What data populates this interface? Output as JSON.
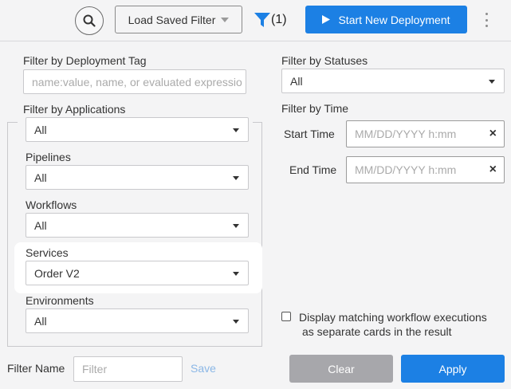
{
  "toolbar": {
    "search_icon": "search-icon",
    "load_saved_filter_label": "Load Saved Filter",
    "filter_count": "(1)",
    "filter_icon_color": "#1c80e4",
    "start_deployment_label": "Start New Deployment",
    "primary_color": "#1c80e4"
  },
  "left": {
    "tag_label": "Filter by Deployment Tag",
    "tag_placeholder": "name:value, name, or evaluated expressio",
    "apps_label": "Filter by Applications",
    "apps_value": "All",
    "pipelines_label": "Pipelines",
    "pipelines_value": "All",
    "workflows_label": "Workflows",
    "workflows_value": "All",
    "services_label": "Services",
    "services_value": "Order V2",
    "environments_label": "Environments",
    "environments_value": "All"
  },
  "right": {
    "statuses_label": "Filter by Statuses",
    "statuses_value": "All",
    "time_label": "Filter by Time",
    "start_time_label": "Start Time",
    "start_time_placeholder": "MM/DD/YYYY h:mm",
    "end_time_label": "End Time",
    "end_time_placeholder": "MM/DD/YYYY h:mm",
    "clear_symbol": "×",
    "display_cards_line1": "Display matching workflow executions",
    "display_cards_line2": "as separate cards in the result"
  },
  "footer": {
    "filter_name_label": "Filter Name",
    "filter_name_placeholder": "Filter",
    "save_label": "Save",
    "clear_label": "Clear",
    "apply_label": "Apply"
  }
}
